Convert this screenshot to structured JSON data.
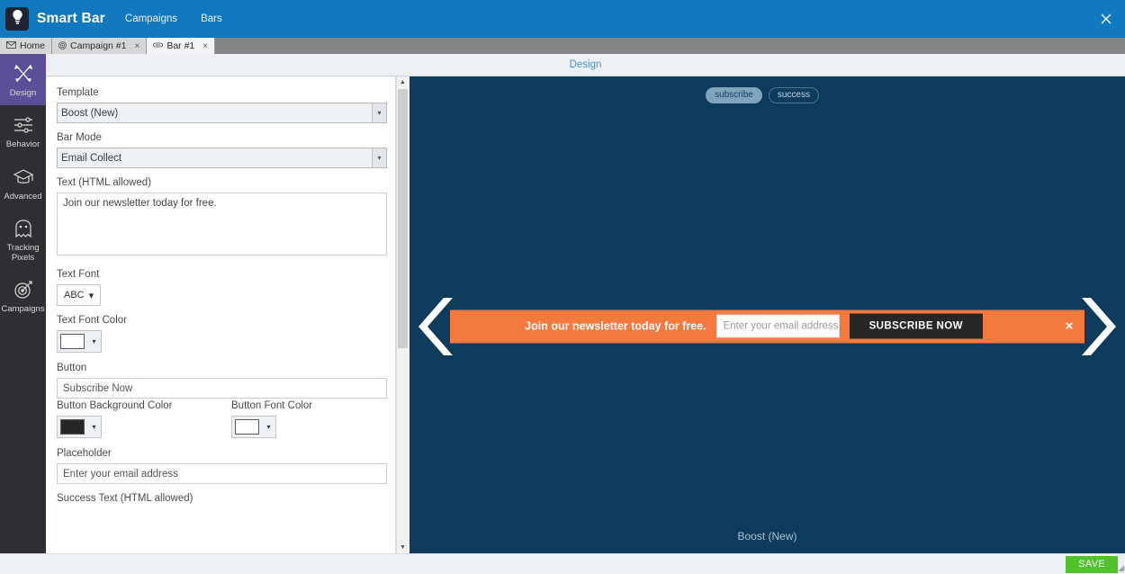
{
  "window": {
    "close_label": "✕"
  },
  "topbar": {
    "logo_icon": "lightbulb-icon",
    "brand": "Smart Bar",
    "nav": [
      {
        "label": "Campaigns"
      },
      {
        "label": "Bars"
      }
    ]
  },
  "tabs": [
    {
      "label": "Home",
      "icon": "envelope-icon",
      "closable": false,
      "active": false
    },
    {
      "label": "Campaign #1",
      "icon": "target-icon",
      "closable": true,
      "close_label": "×",
      "active": false
    },
    {
      "label": "Bar #1",
      "icon": "bar-icon",
      "closable": true,
      "close_label": "×",
      "active": true
    }
  ],
  "sidebar": {
    "items": [
      {
        "label": "Design",
        "icon": "pencils-icon",
        "active": true
      },
      {
        "label": "Behavior",
        "icon": "sliders-icon",
        "active": false
      },
      {
        "label": "Advanced",
        "icon": "graduation-cap-icon",
        "active": false
      },
      {
        "label": "Tracking Pixels",
        "icon": "ghost-icon",
        "active": false
      },
      {
        "label": "Campaigns",
        "icon": "target-icon",
        "active": false
      }
    ]
  },
  "section": {
    "title": "Design"
  },
  "form": {
    "template": {
      "label": "Template",
      "value": "Boost (New)",
      "options": [
        "Boost (New)"
      ]
    },
    "bar_mode": {
      "label": "Bar Mode",
      "value": "Email Collect",
      "options": [
        "Email Collect"
      ]
    },
    "text": {
      "label": "Text (HTML allowed)",
      "value": "Join our newsletter today for free."
    },
    "text_font": {
      "label": "Text Font",
      "value": "ABC",
      "caret": "▾"
    },
    "text_font_color": {
      "label": "Text Font Color",
      "color": "#ffffff",
      "caret": "▾"
    },
    "button": {
      "label": "Button",
      "value": "Subscribe Now"
    },
    "button_bg_color": {
      "label": "Button Background Color",
      "color": "#272727",
      "caret": "▾"
    },
    "button_font_color": {
      "label": "Button Font Color",
      "color": "#ffffff",
      "caret": "▾"
    },
    "placeholder_field": {
      "label": "Placeholder",
      "value": "Enter your email address"
    },
    "success_text": {
      "label": "Success Text (HTML allowed)"
    }
  },
  "scrollbar": {
    "up_arrow": "▲",
    "down_arrow": "▼"
  },
  "preview": {
    "background": "#0c3b5c",
    "modes": [
      {
        "label": "subscribe",
        "selected": true
      },
      {
        "label": "success",
        "selected": false
      }
    ],
    "bar": {
      "background": "#f4793f",
      "text": "Join our newsletter today for free.",
      "input_placeholder": "Enter your email address",
      "button_label": "SUBSCRIBE NOW",
      "button_background": "#272727",
      "button_font_color": "#ffffff",
      "close_label": "✕",
      "prev_arrow_icon": "chevron-left-icon",
      "next_arrow_icon": "chevron-right-icon"
    },
    "caption": "Boost (New)"
  },
  "footer": {
    "save_label": "SAVE",
    "save_color": "#4fc22c"
  }
}
